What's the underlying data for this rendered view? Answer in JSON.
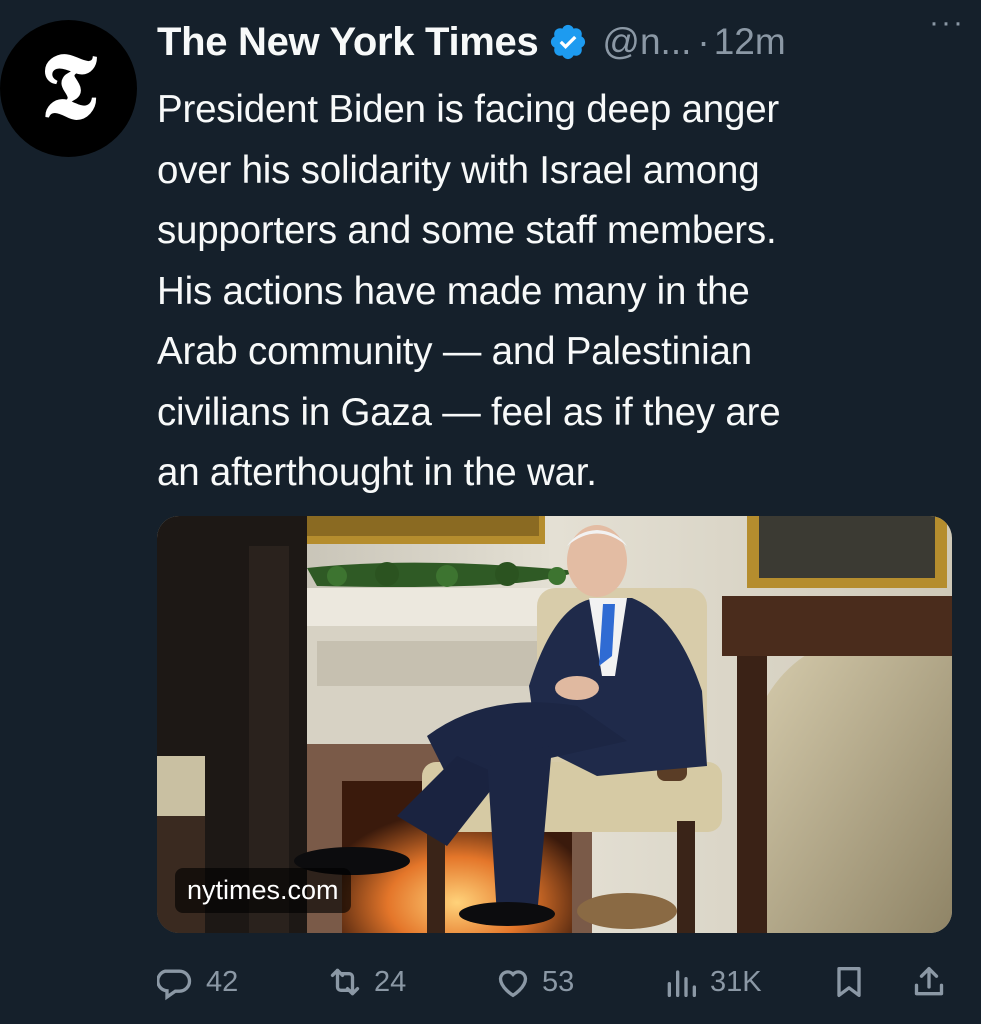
{
  "author": {
    "name": "The New York Times",
    "handle": "@n...",
    "separator": "·",
    "time": "12m",
    "avatar_glyph": "𝕿",
    "verified": true,
    "verified_color": "#1d9bf0"
  },
  "tweet": {
    "text": "President Biden is facing deep anger over his solidarity with Israel among supporters and some staff members. His actions have made many in the Arab community — and Palestinian civilians in Gaza — feel as if they are an afterthought in the war.",
    "lines": [
      "President Biden is facing deep anger",
      "over his solidarity with Israel among",
      "supporters and some staff members.",
      "His actions have made many in the",
      "Arab community — and Palestinian",
      "civilians in Gaza — feel as if they are",
      "an afterthought in the war."
    ]
  },
  "media": {
    "link_label": "nytimes.com"
  },
  "more_label": "···",
  "actions": {
    "replies": {
      "icon": "reply-icon",
      "count": "42"
    },
    "retweets": {
      "icon": "retweet-icon",
      "count": "24"
    },
    "likes": {
      "icon": "heart-icon",
      "count": "53"
    },
    "views": {
      "icon": "views-chart-icon",
      "count": "31K"
    },
    "bookmark": {
      "icon": "bookmark-icon"
    },
    "share": {
      "icon": "share-icon"
    }
  },
  "colors": {
    "background": "#15202b",
    "text": "#f7f9f9",
    "muted": "#8b98a5"
  }
}
